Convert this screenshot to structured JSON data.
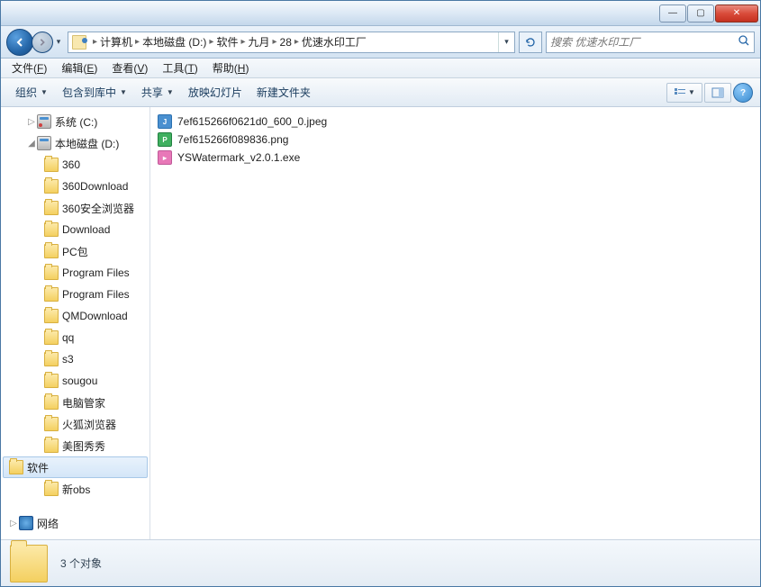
{
  "titlebar": {
    "min": "—",
    "max": "▢",
    "close": "✕"
  },
  "nav": {
    "breadcrumbs": [
      "计算机",
      "本地磁盘 (D:)",
      "软件",
      "九月",
      "28",
      "优速水印工厂"
    ],
    "search_placeholder": "搜索 优速水印工厂"
  },
  "menubar": [
    {
      "label": "文件",
      "key": "F"
    },
    {
      "label": "编辑",
      "key": "E"
    },
    {
      "label": "查看",
      "key": "V"
    },
    {
      "label": "工具",
      "key": "T"
    },
    {
      "label": "帮助",
      "key": "H"
    }
  ],
  "toolbar": {
    "organize": "组织",
    "include": "包含到库中",
    "share": "共享",
    "slideshow": "放映幻灯片",
    "newfolder": "新建文件夹"
  },
  "sidebar": {
    "drives": [
      {
        "label": "系统 (C:)",
        "type": "drive-c"
      },
      {
        "label": "本地磁盘 (D:)",
        "type": "drive",
        "expanded": true
      }
    ],
    "folders": [
      "360",
      "360Download",
      "360安全浏览器",
      "Download",
      "PC包",
      "Program Files",
      "Program Files",
      "QMDownload",
      "qq",
      "s3",
      "sougou",
      "电脑管家",
      "火狐浏览器",
      "美图秀秀",
      "软件",
      "新obs"
    ],
    "network": "网络"
  },
  "files": [
    {
      "name": "7ef615266f0621d0_600_0.jpeg",
      "type": "jpeg"
    },
    {
      "name": "7ef615266f089836.png",
      "type": "png"
    },
    {
      "name": "YSWatermark_v2.0.1.exe",
      "type": "exe"
    }
  ],
  "status": {
    "text": "3 个对象"
  }
}
